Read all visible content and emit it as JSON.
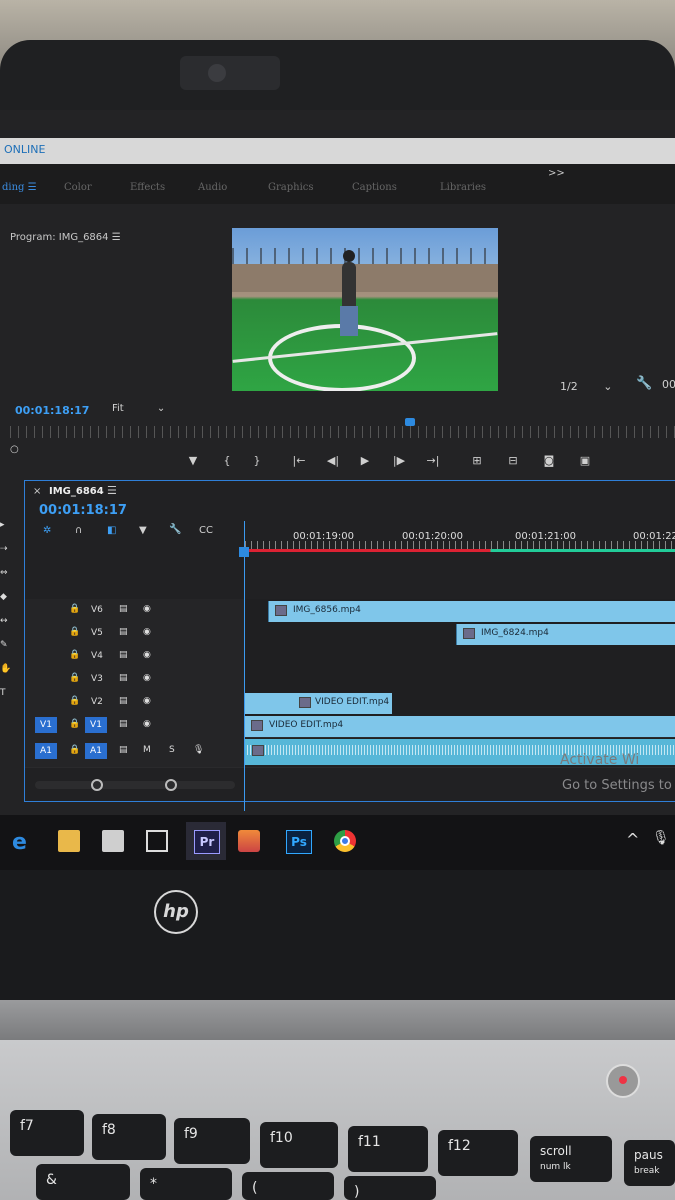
{
  "app": {
    "online_label": "ONLINE",
    "workspace_tabs": [
      "Color",
      "Effects",
      "Audio",
      "Graphics",
      "Captions",
      "Libraries"
    ],
    "more_label": ">>"
  },
  "program_monitor": {
    "title": "Program: IMG_6864",
    "timecode": "00:01:18:17",
    "fit": "Fit",
    "resolution": "1/2",
    "right_timecode": "00"
  },
  "timeline": {
    "sequence_name": "IMG_6864",
    "timecode": "00:01:18:17",
    "ruler_times": [
      "00:01:19:00",
      "00:01:20:00",
      "00:01:21:00",
      "00:01:22"
    ],
    "tracks": [
      {
        "id": "V6",
        "clips": [
          {
            "name": "IMG_6856.mp4"
          }
        ]
      },
      {
        "id": "V5",
        "clips": [
          {
            "name": "IMG_6824.mp4"
          }
        ]
      },
      {
        "id": "V4",
        "clips": []
      },
      {
        "id": "V3",
        "clips": []
      },
      {
        "id": "V2",
        "clips": [
          {
            "name": "VIDEO EDIT.mp4"
          }
        ]
      },
      {
        "id": "V1",
        "source": "V1",
        "clips": [
          {
            "name": "VIDEO EDIT.mp4"
          }
        ]
      },
      {
        "id": "A1",
        "source": "A1",
        "mute": "M",
        "solo": "S",
        "clips": []
      }
    ]
  },
  "overlay": {
    "activate": "Activate Wi",
    "settings": "Go to Settings to"
  },
  "taskbar": {
    "icons": [
      "edge-icon",
      "file-explorer-icon",
      "store-icon",
      "mail-icon",
      "premiere-pro-icon",
      "app-icon",
      "photoshop-icon",
      "chrome-icon"
    ],
    "pr": "Pr",
    "ps": "Ps",
    "tray_up": "^"
  },
  "laptop": {
    "brand": "hp",
    "keys": [
      "f7",
      "f8",
      "f9",
      "f10",
      "f11",
      "f12",
      "scroll",
      "paus"
    ],
    "key_sub": [
      "num lk",
      "break"
    ],
    "number_row": [
      "&",
      "*",
      "(",
      ")"
    ]
  },
  "colors": {
    "accent": "#2d8ae0",
    "clip": "#7fc6ea",
    "audio": "#57b7d8"
  }
}
